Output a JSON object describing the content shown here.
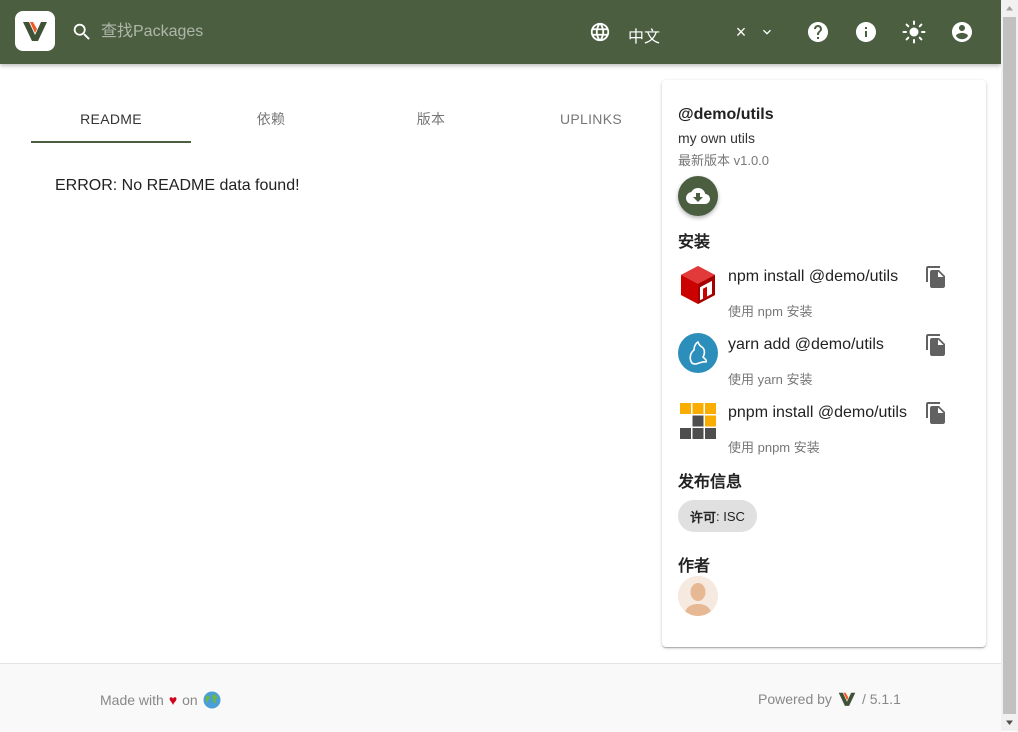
{
  "header": {
    "search_placeholder": "查找Packages",
    "language": "中文",
    "clear_symbol": "×"
  },
  "tabs": [
    {
      "label": "README"
    },
    {
      "label": "依赖"
    },
    {
      "label": "版本"
    },
    {
      "label": "UPLINKS"
    }
  ],
  "readme": {
    "error": "ERROR: No README data found!"
  },
  "package": {
    "name": "@demo/utils",
    "description": "my own utils",
    "latest_version": "最新版本 v1.0.0"
  },
  "install": {
    "title": "安装",
    "items": [
      {
        "command": "npm install @demo/utils",
        "sub": "使用 npm 安装",
        "icon": "npm-logo"
      },
      {
        "command": "yarn add @demo/utils",
        "sub": "使用 yarn 安装",
        "icon": "yarn-logo"
      },
      {
        "command": "pnpm install @demo/utils",
        "sub": "使用 pnpm 安装",
        "icon": "pnpm-logo"
      }
    ]
  },
  "distribution": {
    "title": "发布信息",
    "license_label": "许可",
    "license_value": ": ISC"
  },
  "author": {
    "title": "作者"
  },
  "footer": {
    "made_with": "Made with",
    "heart": "♥",
    "on": "on",
    "powered_by": "Powered by",
    "version": "/ 5.1.1"
  },
  "colors": {
    "brand": "#4b5e40",
    "npm": "#cb0000",
    "yarn": "#2c8ebb",
    "pnpm_orange": "#f9ad00",
    "pnpm_gray": "#4e4e4e"
  }
}
